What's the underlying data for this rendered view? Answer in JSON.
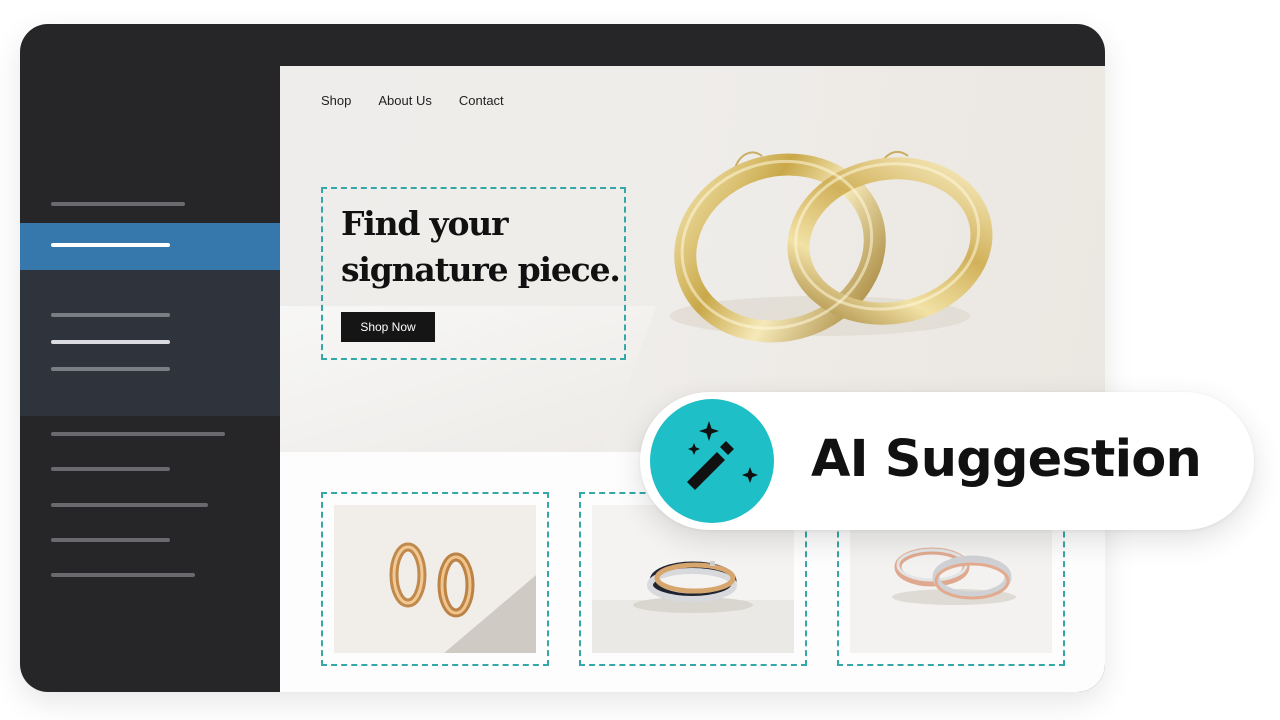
{
  "nav": {
    "links": [
      "Shop",
      "About Us",
      "Contact"
    ]
  },
  "hero": {
    "headline": "Find your\nsignature piece.",
    "cta_label": "Shop Now"
  },
  "products": [
    {
      "image": "gold-huggie-earrings"
    },
    {
      "image": "tri-tone-rolling-rings"
    },
    {
      "image": "two-tone-band-rings"
    }
  ],
  "ai_suggestion": {
    "label": "AI Suggestion",
    "icon": "magic-wand-icon"
  },
  "colors": {
    "sidebar_bg": "#262628",
    "sidebar_active": "#3778ac",
    "selection_dashed": "#34a7a7",
    "ai_accent": "#1fbfc7",
    "cta_bg": "#151515"
  }
}
